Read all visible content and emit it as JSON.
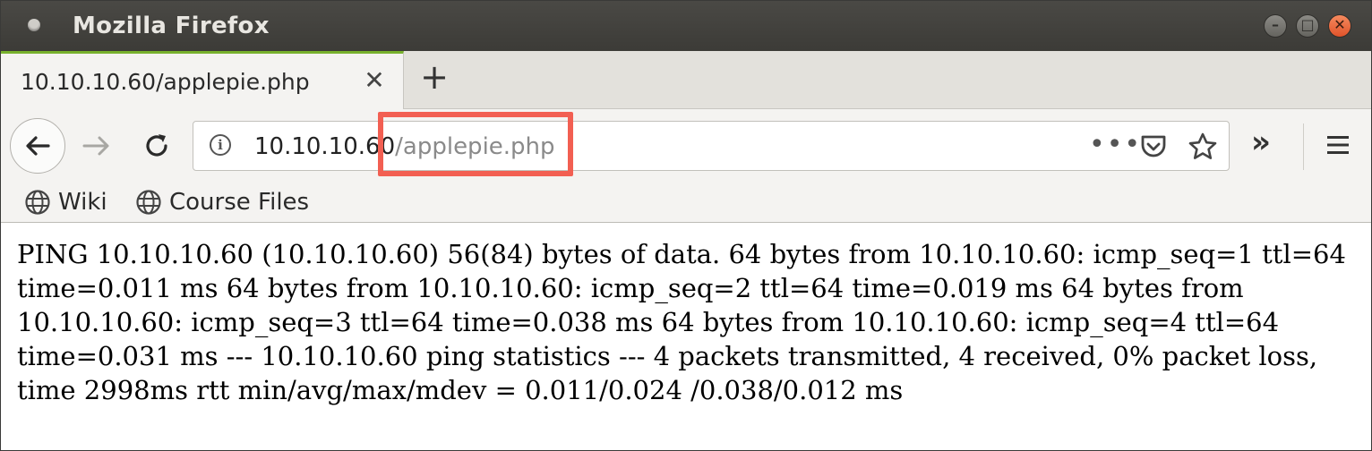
{
  "window": {
    "title": "Mozilla Firefox",
    "controls": {
      "minimize": "–",
      "maximize": "□",
      "close": "✕"
    }
  },
  "tabs": [
    {
      "title": "10.10.10.60/applepie.php",
      "close": "✕"
    }
  ],
  "new_tab": "+",
  "navbar": {
    "url_host": "10.10.10.60",
    "url_path": "/applepie.php",
    "page_actions": "•••",
    "overflow": "»",
    "info": "i"
  },
  "bookmarks": [
    {
      "label": "Wiki",
      "icon": "globe-icon"
    },
    {
      "label": "Course Files",
      "icon": "globe-icon"
    }
  ],
  "page": {
    "text": "PING 10.10.10.60 (10.10.10.60) 56(84) bytes of data. 64 bytes from 10.10.10.60: icmp_seq=1 ttl=64 time=0.011 ms 64 bytes from 10.10.10.60: icmp_seq=2 ttl=64 time=0.019 ms 64 bytes from 10.10.10.60: icmp_seq=3 ttl=64 time=0.038 ms 64 bytes from 10.10.10.60: icmp_seq=4 ttl=64 time=0.031 ms --- 10.10.10.60 ping statistics --- 4 packets transmitted, 4 received, 0% packet loss, time 2998ms rtt min/avg/max/mdev = 0.011/0.024 /0.038/0.012 ms"
  },
  "colors": {
    "highlight": "#f25f52",
    "tab_accent": "#78b12d",
    "titlebar": "#3c3b37",
    "close_button": "#e0532a"
  }
}
